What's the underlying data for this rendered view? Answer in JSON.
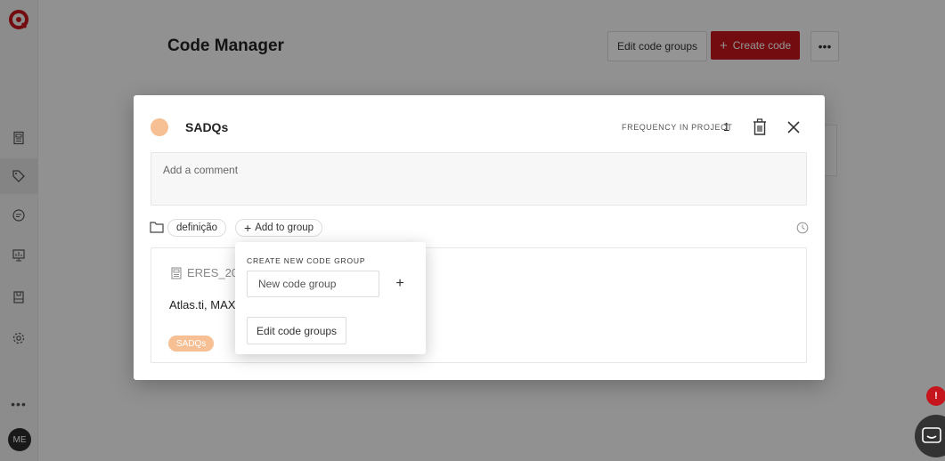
{
  "app": {
    "title": "Code Manager",
    "edit_code_groups_label": "Edit code groups",
    "create_code_label": "Create code",
    "more_label": "•••",
    "avatar_initials": "ME",
    "sidebar_more": "•••",
    "chat_badge": "!",
    "colors": {
      "brand": "#c4161c",
      "code": "#f6bf94"
    }
  },
  "modal": {
    "code_name": "SADQs",
    "frequency_label": "FREQUENCY IN PROJECT",
    "frequency_value": "1",
    "comment_placeholder": "Add a comment",
    "groups": [
      "definição"
    ],
    "add_to_group_label": "Add to group",
    "quotation": {
      "document_name": "ERES_20",
      "text": "Atlas.ti, MAX",
      "code_tag": "SADQs"
    }
  },
  "popover": {
    "title": "CREATE NEW CODE GROUP",
    "input_placeholder": "New code group",
    "add_symbol": "+",
    "edit_button_label": "Edit code groups"
  }
}
